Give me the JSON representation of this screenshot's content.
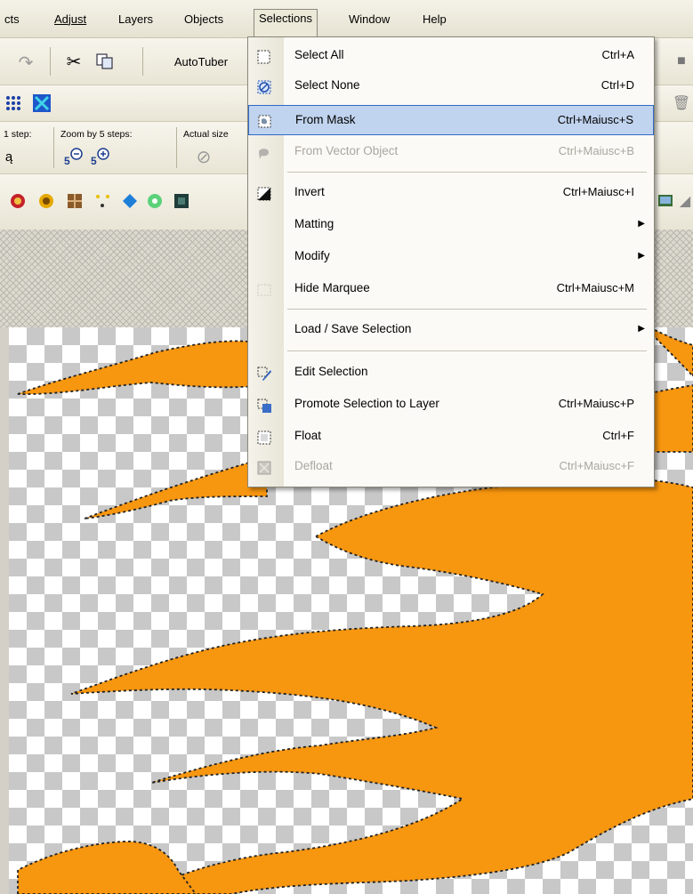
{
  "menubar": {
    "items": [
      "cts",
      "Adjust",
      "Layers",
      "Objects",
      "Selections",
      "Window",
      "Help"
    ]
  },
  "toolbar1": {
    "autotuber_label": "AutoTuber"
  },
  "toolbar3": {
    "step_label": "1 step:",
    "zoom5_label": "Zoom by 5 steps:",
    "actual_size_label": "Actual size"
  },
  "selections_menu": {
    "items": [
      {
        "label": "Select All",
        "shortcut": "Ctrl+A",
        "icon": "select-all-icon"
      },
      {
        "label": "Select None",
        "shortcut": "Ctrl+D",
        "icon": "select-none-icon"
      },
      {
        "label": "From Mask",
        "shortcut": "Ctrl+Maiusc+S",
        "icon": "from-mask-icon",
        "highlighted": true
      },
      {
        "label": "From Vector Object",
        "shortcut": "Ctrl+Maiusc+B",
        "icon": "vector-object-icon",
        "disabled": true
      },
      {
        "label": "Invert",
        "shortcut": "Ctrl+Maiusc+I",
        "icon": "invert-icon"
      },
      {
        "label": "Matting",
        "shortcut": "",
        "submenu": true
      },
      {
        "label": "Modify",
        "shortcut": "",
        "submenu": true
      },
      {
        "label": "Hide Marquee",
        "shortcut": "Ctrl+Maiusc+M",
        "icon": "hide-marquee-icon"
      },
      {
        "label": "Load / Save Selection",
        "shortcut": "",
        "submenu": true
      },
      {
        "label": "Edit Selection",
        "shortcut": "",
        "icon": "edit-selection-icon"
      },
      {
        "label": "Promote Selection to Layer",
        "shortcut": "Ctrl+Maiusc+P",
        "icon": "promote-layer-icon"
      },
      {
        "label": "Float",
        "shortcut": "Ctrl+F",
        "icon": "float-icon"
      },
      {
        "label": "Defloat",
        "shortcut": "Ctrl+Maiusc+F",
        "icon": "defloat-icon",
        "disabled": true
      }
    ]
  },
  "colors": {
    "flame": "#f7960f",
    "highlight": "#c1d4ef",
    "highlight_border": "#3169c6"
  }
}
